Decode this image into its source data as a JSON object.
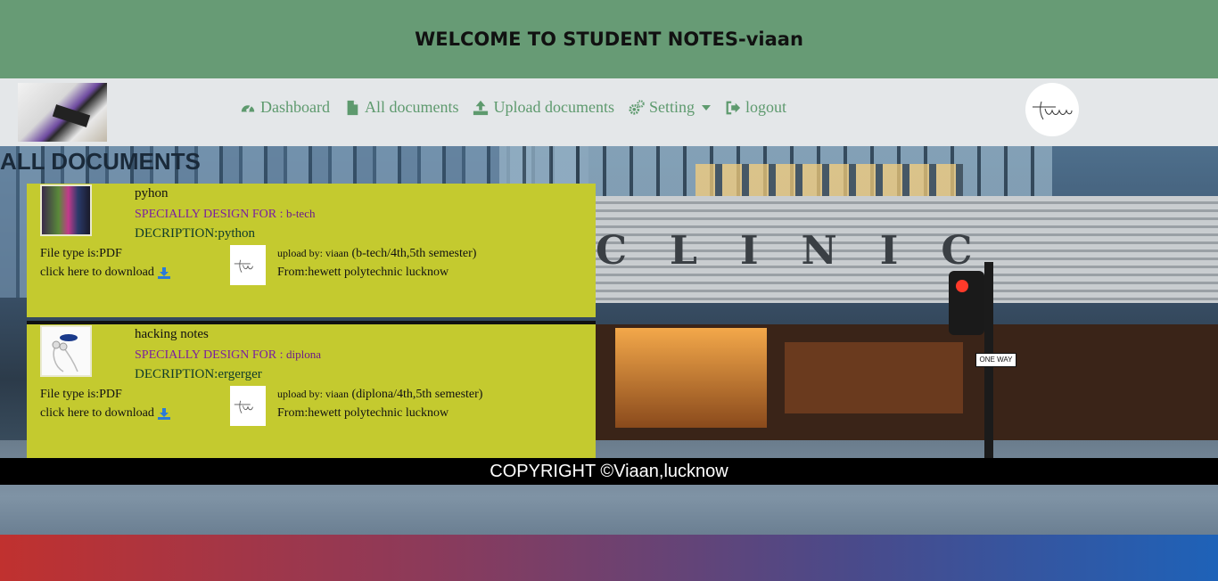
{
  "header": {
    "title": "WELCOME TO STUDENT NOTES-viaan"
  },
  "nav": {
    "links": [
      {
        "label": "Dashboard",
        "icon": "dashboard-icon"
      },
      {
        "label": "All documents",
        "icon": "file-icon"
      },
      {
        "label": "Upload documents",
        "icon": "upload-icon"
      },
      {
        "label": "Setting",
        "icon": "gears-icon"
      },
      {
        "label": "logout",
        "icon": "logout-icon"
      }
    ],
    "avatar_text": "Viaan"
  },
  "page": {
    "heading": "ALL DOCUMENTS"
  },
  "documents": [
    {
      "title": "pyhon",
      "for_label": "SPECIALLY DESIGN FOR :",
      "for_value": "b-tech",
      "description": "DECRIPTION:python",
      "file_type": "File type is:PDF",
      "download": "click here to download",
      "upload_label": "upload by: viaan",
      "upload_detail": "(b-tech/4th,5th semester)",
      "from": "From:hewett polytechnic lucknow"
    },
    {
      "title": "hacking notes",
      "for_label": "SPECIALLY DESIGN FOR :",
      "for_value": "diplona",
      "description": "DECRIPTION:ergerger",
      "file_type": "File type is:PDF",
      "download": "click here to download",
      "upload_label": "upload by: viaan",
      "upload_detail": "(diplona/4th,5th semester)",
      "from": "From:hewett polytechnic lucknow"
    }
  ],
  "footer": {
    "text": "COPYRIGHT ©Viaan,lucknow"
  },
  "colors": {
    "header_bg": "#679b75",
    "nav_bg": "#e4e7e9",
    "nav_link": "#5e9a6e",
    "card_bg": "#c4ca2f",
    "for_text": "#7a1fa0",
    "download_icon": "#2a7ad8",
    "footer_bg": "#000000"
  }
}
